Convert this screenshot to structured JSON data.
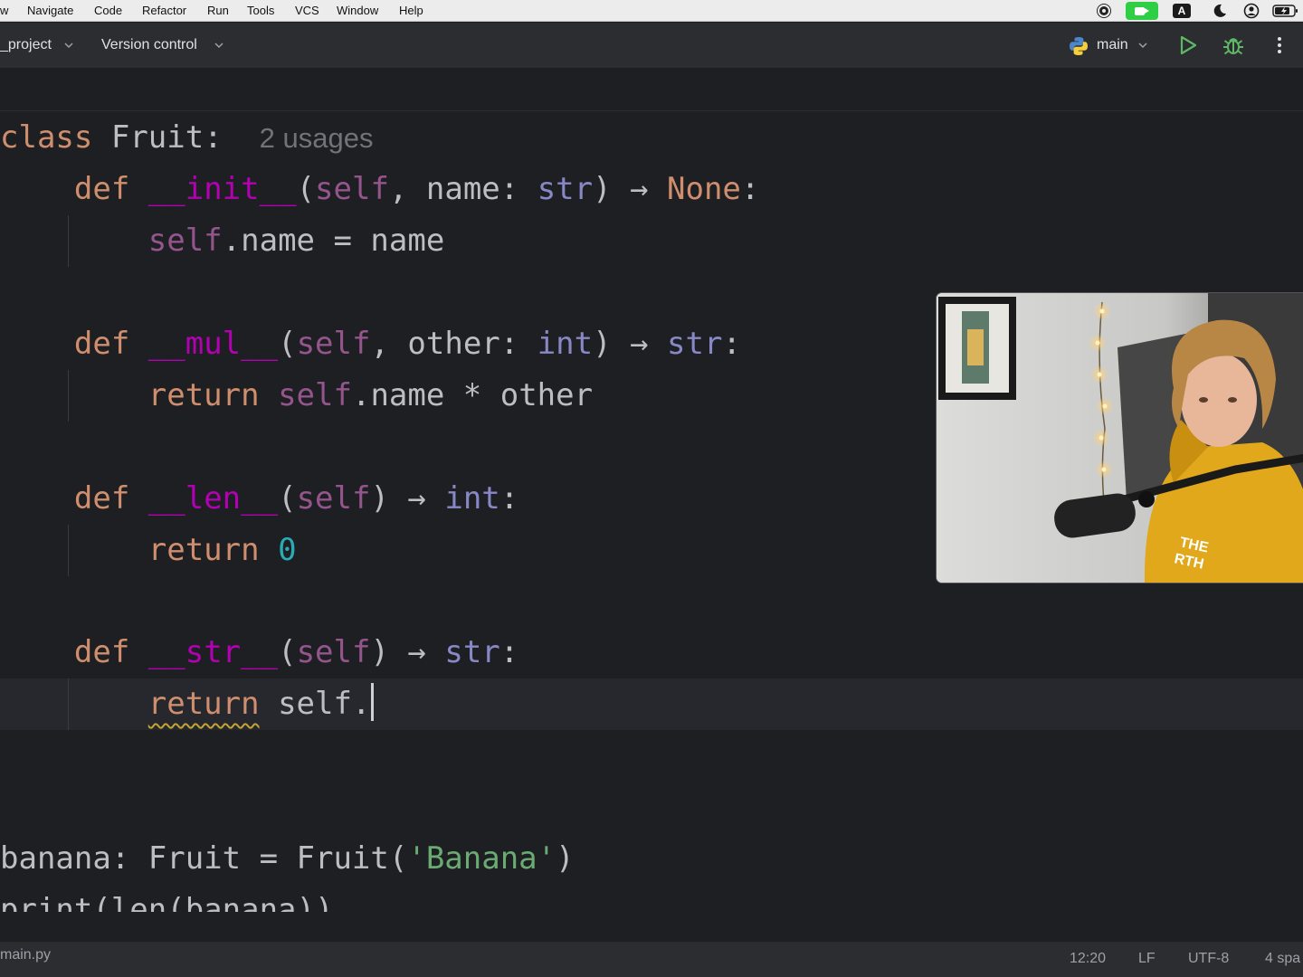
{
  "menubar": {
    "items": [
      "w",
      "Navigate",
      "Code",
      "Refactor",
      "Run",
      "Tools",
      "VCS",
      "Window",
      "Help"
    ]
  },
  "toolbar": {
    "project": "_project",
    "vcs": "Version control",
    "run_config": "main"
  },
  "editor": {
    "language": "python",
    "caret_line": "return self.",
    "lines": {
      "l1": {
        "kw": "class",
        "name": "Fruit",
        "colon": ":",
        "hint": "2 usages"
      },
      "l2": {
        "kw": "def",
        "fn": "__init__",
        "p1": "(",
        "self": "self",
        "p2": ", name: ",
        "typ": "str",
        "p3": ") → ",
        "ret": "None",
        "p4": ":"
      },
      "l3": {
        "self": "self",
        "rest": ".name = name"
      },
      "l4": {
        "kw": "def",
        "fn": "__mul__",
        "p1": "(",
        "self": "self",
        "p2": ", other: ",
        "typ": "int",
        "p3": ") → ",
        "ret": "str",
        "p4": ":"
      },
      "l5": {
        "kw": "return",
        "self": "self",
        "rest": ".name * other"
      },
      "l6": {
        "kw": "def",
        "fn": "__len__",
        "p1": "(",
        "self": "self",
        "p3": ") → ",
        "ret": "int",
        "p4": ":"
      },
      "l7": {
        "kw": "return",
        "num": "0"
      },
      "l8": {
        "kw": "def",
        "fn": "__str__",
        "p1": "(",
        "self": "self",
        "p3": ") → ",
        "ret": "str",
        "p4": ":"
      },
      "l9": {
        "kw": "return",
        "rest": "self."
      },
      "l10": {
        "a": "banana: Fruit = Fruit(",
        "str": "'Banana'",
        "b": ")"
      },
      "l11": {
        "a": "print(len(banana))"
      }
    }
  },
  "statusbar": {
    "file": "main.py",
    "position": "12:20",
    "line_sep": "LF",
    "encoding": "UTF-8",
    "indent": "4 spa"
  },
  "colors": {
    "keyword": "#cf8e6d",
    "magic_method": "#b200b2",
    "self": "#94558d",
    "builtin_type": "#8888c6",
    "number": "#2aacb8",
    "string": "#6aab73",
    "run_green": "#5fb865"
  },
  "icons": [
    "record-icon",
    "camera-icon",
    "input-source-icon",
    "focus-moon-icon",
    "user-icon",
    "battery-icon",
    "python-icon",
    "chevron-down-icon",
    "run-icon",
    "debug-icon",
    "more-vertical-icon"
  ]
}
